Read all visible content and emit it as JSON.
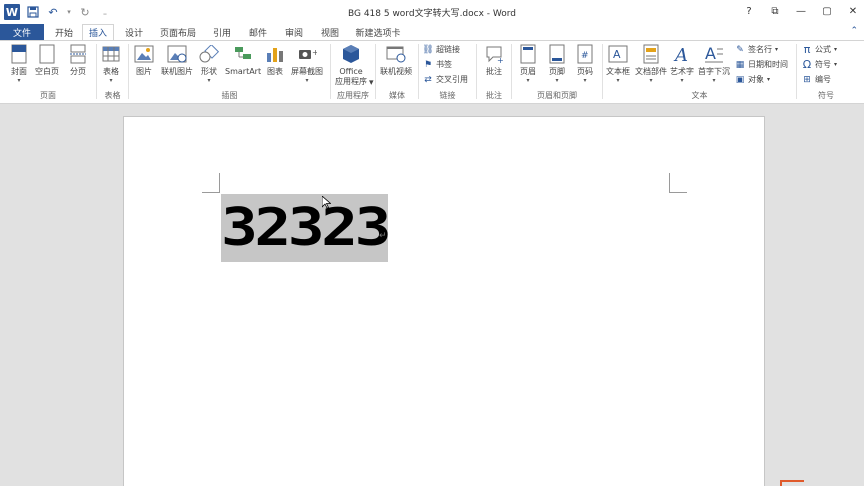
{
  "window": {
    "title": "BG 418 5 word文字转大写.docx - Word",
    "logo": "W",
    "controls": [
      "?",
      "⧉",
      "—",
      "▢",
      "✕"
    ]
  },
  "qat": [
    "save-icon",
    "undo-icon",
    "redo-icon",
    "customize-icon"
  ],
  "tabs": {
    "file": "文件",
    "items": [
      "开始",
      "插入",
      "设计",
      "页面布局",
      "引用",
      "邮件",
      "审阅",
      "视图",
      "新建选项卡"
    ],
    "active": "插入"
  },
  "ribbon": {
    "pages": {
      "label": "页面",
      "cover": "封面",
      "blank": "空白页",
      "break": "分页"
    },
    "tables": {
      "label": "表格",
      "table": "表格"
    },
    "illustrations": {
      "label": "插图",
      "picture": "图片",
      "online": "联机图片",
      "shapes": "形状",
      "smartart": "SmartArt",
      "chart": "图表",
      "screenshot": "屏幕截图"
    },
    "apps": {
      "label": "应用程序",
      "office_line1": "Office",
      "office_line2": "应用程序"
    },
    "media": {
      "label": "媒体",
      "video": "联机视频"
    },
    "links": {
      "label": "链接",
      "hyperlink": "超链接",
      "bookmark": "书签",
      "cross": "交叉引用"
    },
    "comments": {
      "label": "批注",
      "comment": "批注"
    },
    "header_footer": {
      "label": "页眉和页脚",
      "header": "页眉",
      "footer": "页脚",
      "pagenum": "页码"
    },
    "text": {
      "label": "文本",
      "textbox": "文本框",
      "parts": "文档部件",
      "wordart": "艺术字",
      "dropcap": "首字下沉",
      "signature": "签名行",
      "datetime": "日期和时间",
      "object": "对象"
    },
    "symbols": {
      "label": "符号",
      "equation": "公式",
      "symbol": "符号",
      "number": "编号"
    }
  },
  "document": {
    "text": "32323",
    "paragraph_mark": "↵"
  }
}
